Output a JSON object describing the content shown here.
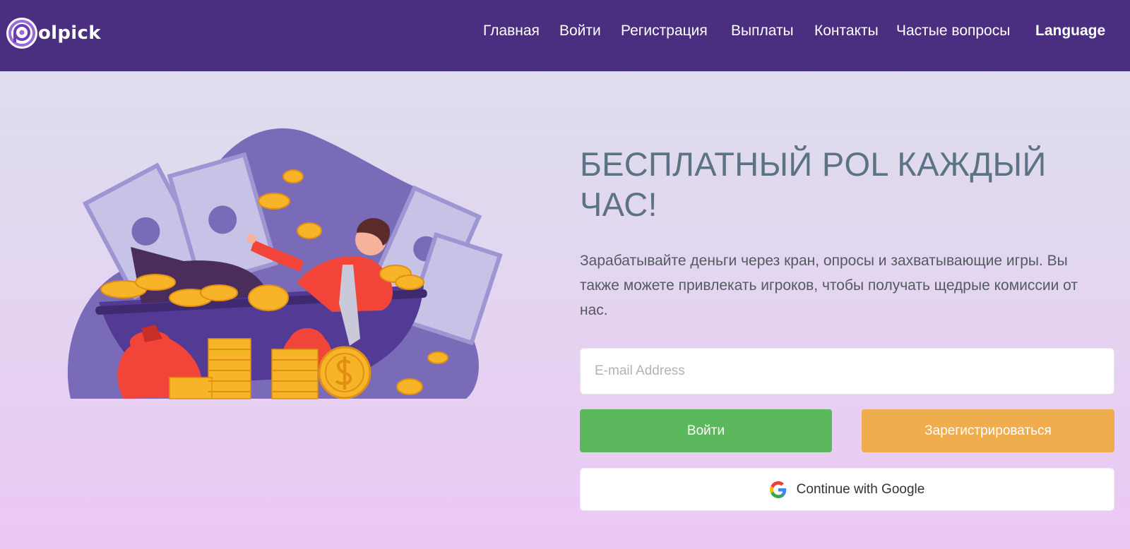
{
  "brand": {
    "logo_text": "olpick"
  },
  "nav": [
    {
      "label": "Главная"
    },
    {
      "label": "Войти"
    },
    {
      "label": "Регистрация"
    },
    {
      "label": "Выплаты"
    },
    {
      "label": "Контакты"
    },
    {
      "label": "Частые вопросы"
    },
    {
      "label": "Language"
    }
  ],
  "hero": {
    "title": "БЕСПЛАТНЫЙ POL КАЖДЫЙ ЧАС!",
    "description": "Зарабатывайте деньги через кран, опросы и захватывающие игры. Вы также можете привлекать игроков, чтобы получать щедрые комиссии от нас.",
    "email_placeholder": "E-mail Address",
    "login_label": "Войти",
    "register_label": "Зарегистрироваться",
    "google_label": "Continue with Google"
  },
  "icons": {
    "logo": "polpick-logo-icon",
    "google": "google-g-icon",
    "illustration": "man-in-money-bathtub-illustration"
  },
  "colors": {
    "header_bg": "#4a2f80",
    "title": "#5c7385",
    "login_button": "#5cb85c",
    "register_button": "#f0ad4e",
    "blob": "#7a6bb8"
  }
}
